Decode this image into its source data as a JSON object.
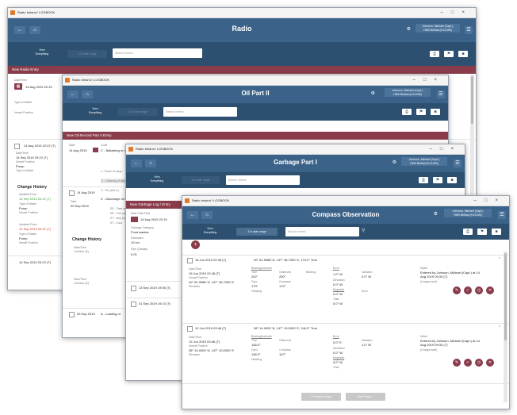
{
  "app_name": "Radio Ireland / LOGBOOK",
  "view_label": "View",
  "view_value": "Everything",
  "filter_label": "3 in date range",
  "search_placeholder": "Search entries",
  "user_line1": "Johnson, Michael (Capt.)",
  "user_line2": "HMS Belfast (H1/UOB)",
  "windows": {
    "radio": {
      "title": "Radio",
      "entry_bar": "New Radio Entry",
      "date_label": "Date/Time",
      "date_value": "14 Aug 2019 22:19",
      "type_label": "Type of Watch",
      "vessel_label": "Vessel Position",
      "list": [
        {
          "date": "14 Aug 2019 22:22 (T)"
        },
        {
          "date": "15 Aug 2019 09:10 (T)"
        },
        {
          "date": "16 Aug 2019 23:05 (T)"
        }
      ],
      "side_date_label": "Date/Time",
      "side_date_value": "14 Sep 2019 20:22 (T)",
      "side_vessel_label": "Vessel Position",
      "side_vessel_value": "Pump",
      "side_watch_label": "Type of Watch",
      "change_history": "Change History",
      "ch_items": [
        {
          "label": "Updated From",
          "value": "14 Sep 2019 20:22 (T)",
          "color": "green"
        },
        {
          "label": "Type of Watch",
          "value": "Pump"
        },
        {
          "label": "Vessel Position",
          "value": ""
        },
        {
          "label": "Updated From",
          "value": "14 Sep 2019 20:22 (T)",
          "color": "red"
        },
        {
          "label": "Type of Watch",
          "value": "Pump"
        },
        {
          "label": "Vessel Position",
          "value": ""
        }
      ],
      "bottom_date": "14 Sep 2019 20:22 (T)"
    },
    "oil": {
      "title": "Oil Part II",
      "entry_bar": "New Oil Record Part II Entry",
      "date_label": "Date",
      "date_value": "14 Aug 2019",
      "code_label": "Code",
      "code_value": "C - Ballasting or cleaning of cargo tanks",
      "list_items": [
        "1 - Place of cargo",
        "2 - Cleaning of cargo tanks",
        "3 - Yes (see A)"
      ],
      "row_date": "14 Aug 2019",
      "row_text": "C - Discharge of dirty ballast or tank washings",
      "detail_date": "09 Sep 2019",
      "detail_items": [
        "RE - Date and",
        "RE - Port (s)",
        "ST - ship (s)",
        "ST - Loca"
      ],
      "change_history": "Change History",
      "ch_date_label": "Date/Time",
      "ch_person": "Johnson (A)",
      "bottom_date": "09 Sep 2019",
      "bottom_text": "A - Loading of"
    },
    "garbage": {
      "title": "Garbage Part I",
      "entry_bar": "New Garbage Log / Entry",
      "start_label": "Start Date/Time",
      "start_value": "14 Aug 2019 22:19",
      "category_label": "Garbage Category",
      "category_value": "Food wastes",
      "qty_label": "Estimated",
      "qty_value": "10 cm",
      "qty2_label": "Pipe Quantity",
      "qty2_value": "0.01",
      "row1_date": "13 Sep 2019 19:06 (T)",
      "row2_date": "01 Sep 2019 19:10 (T)"
    },
    "compass": {
      "title": "Compass Observation",
      "add_btn": "+",
      "entries": [
        {
          "header_date": "16 Jun 2019 22:45 (T)",
          "header_pos": "40° 51.9988' N, 147° 46.7000' E, 173.0° True",
          "date_label": "Date/Time",
          "date_value": "16 Jun 2019 22:45 (T)",
          "pos_label": "Vessel Position",
          "pos_value": "40° 51.9988' N, 147° 46.7000' E",
          "remarks_label": "Remarks",
          "bearing_label": "Bearing/Azimuth",
          "true_label": "True",
          "true_value": "202°",
          "gyro_label": "Gyro",
          "gyro_value": "173°",
          "obs_label": "Observed",
          "obs_value": "200°",
          "comp_label": "Compass",
          "comp_value": "172°",
          "heading_label": "Heading",
          "variation_label": "Variation",
          "variation_value": "0.0° W",
          "deviation_label": "Deviation",
          "deviation_value": "0.0° W",
          "error_label": "Error",
          "error_value": "1.0° W",
          "bearing2_label": "Bearing",
          "errcomp_label": "Error",
          "errcomp_value": "2.0° E",
          "mag_label": "Magnetic",
          "mag_value": "0.0° W",
          "total_label": "Total",
          "total_value": "0.0° W",
          "note_label": "Notes",
          "note_value": "Entered by Johnson, Michael (Capt.) at 14 Aug 2019 09:33 (T)",
          "note_sub": "(Unapproved)"
        },
        {
          "header_date": "12 Jun 2019 03:46 (T)",
          "header_pos": "38° 14.0000' N, 147° 10.0000' E, 146.0° True",
          "date_label": "Date/Time",
          "date_value": "12 Jun 2019 03:46 (T)",
          "pos_label": "Vessel Position",
          "pos_value": "38° 14.0000' N, 147° 10.0000' E",
          "remarks_label": "Remarks",
          "bearing_label": "Bearing/Azimuth",
          "true_label": "True",
          "true_value": "146.0°",
          "gyro_label": "Gyro",
          "gyro_value": "146.0°",
          "obs_label": "Observed",
          "obs_value": "",
          "comp_label": "Compass",
          "comp_value": "147°",
          "heading_label": "Heading",
          "variation_label": "Variation",
          "variation_value": "1.0° W",
          "deviation_label": "Deviation",
          "deviation_value": "0.0° W",
          "error_label": "Error",
          "error_value": "0.0° E",
          "mag_label": "Magnetic",
          "mag_value": "0.0° W",
          "total_label": "Total",
          "total_value": "",
          "note_label": "Notes",
          "note_value": "Entered by Johnson, Michael (Capt.) at 14 Aug 2019 09:33 (T)",
          "note_sub": "(Unapproved)"
        }
      ],
      "footer_prev": "< Previous Page",
      "footer_next": "Next Page >"
    }
  },
  "colors": {
    "header": "#3b6289",
    "subheader": "#2e5070",
    "entry_bar": "#8a3c4b",
    "accent": "#e07b2a"
  }
}
